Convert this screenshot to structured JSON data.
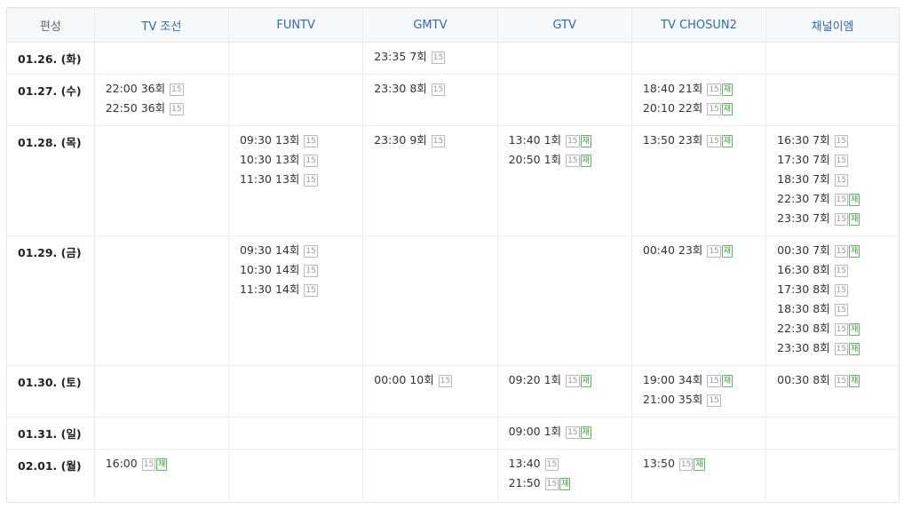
{
  "header": [
    "편성",
    "TV 조선",
    "FUNTV",
    "GMTV",
    "GTV",
    "TV CHOSUN2",
    "채널이엠"
  ],
  "rows": [
    {
      "date": "01.26. (화)",
      "h": 36,
      "cells": [
        [],
        [],
        [
          {
            "time": "23:35",
            "ep": "7회",
            "rating": "15",
            "re": ""
          }
        ],
        [],
        [],
        []
      ]
    },
    {
      "date": "01.27. (수)",
      "h": 58,
      "cells": [
        [
          {
            "time": "22:00",
            "ep": "36회",
            "rating": "15",
            "re": ""
          },
          {
            "time": "22:50",
            "ep": "36회",
            "rating": "15",
            "re": ""
          }
        ],
        [],
        [
          {
            "time": "23:30",
            "ep": "8회",
            "rating": "15",
            "re": ""
          }
        ],
        [],
        [
          {
            "time": "18:40",
            "ep": "21회",
            "rating": "15",
            "re": "재"
          },
          {
            "time": "20:10",
            "ep": "22회",
            "rating": "15",
            "re": "재"
          }
        ],
        []
      ]
    },
    {
      "date": "01.28. (목)",
      "h": 124,
      "cells": [
        [],
        [
          {
            "time": "09:30",
            "ep": "13회",
            "rating": "15",
            "re": ""
          },
          {
            "time": "10:30",
            "ep": "13회",
            "rating": "15",
            "re": ""
          },
          {
            "time": "11:30",
            "ep": "13회",
            "rating": "15",
            "re": ""
          }
        ],
        [
          {
            "time": "23:30",
            "ep": "9회",
            "rating": "15",
            "re": ""
          }
        ],
        [
          {
            "time": "13:40",
            "ep": "1회",
            "rating": "15",
            "re": "재"
          },
          {
            "time": "20:50",
            "ep": "1회",
            "rating": "15",
            "re": "재"
          }
        ],
        [
          {
            "time": "13:50",
            "ep": "23회",
            "rating": "15",
            "re": "재"
          }
        ],
        [
          {
            "time": "16:30",
            "ep": "7회",
            "rating": "15",
            "re": ""
          },
          {
            "time": "17:30",
            "ep": "7회",
            "rating": "15",
            "re": ""
          },
          {
            "time": "18:30",
            "ep": "7회",
            "rating": "15",
            "re": ""
          },
          {
            "time": "22:30",
            "ep": "7회",
            "rating": "15",
            "re": "재"
          },
          {
            "time": "23:30",
            "ep": "7회",
            "rating": "15",
            "re": "재"
          }
        ]
      ]
    },
    {
      "date": "01.29. (금)",
      "h": 146,
      "cells": [
        [],
        [
          {
            "time": "09:30",
            "ep": "14회",
            "rating": "15",
            "re": ""
          },
          {
            "time": "10:30",
            "ep": "14회",
            "rating": "15",
            "re": ""
          },
          {
            "time": "11:30",
            "ep": "14회",
            "rating": "15",
            "re": ""
          }
        ],
        [],
        [],
        [
          {
            "time": "00:40",
            "ep": "23회",
            "rating": "15",
            "re": "재"
          }
        ],
        [
          {
            "time": "00:30",
            "ep": "7회",
            "rating": "15",
            "re": "재"
          },
          {
            "time": "16:30",
            "ep": "8회",
            "rating": "15",
            "re": ""
          },
          {
            "time": "17:30",
            "ep": "8회",
            "rating": "15",
            "re": ""
          },
          {
            "time": "18:30",
            "ep": "8회",
            "rating": "15",
            "re": ""
          },
          {
            "time": "22:30",
            "ep": "8회",
            "rating": "15",
            "re": "재"
          },
          {
            "time": "23:30",
            "ep": "8회",
            "rating": "15",
            "re": "재"
          }
        ]
      ]
    },
    {
      "date": "01.30. (토)",
      "h": 58,
      "cells": [
        [],
        [],
        [
          {
            "time": "00:00",
            "ep": "10회",
            "rating": "15",
            "re": ""
          }
        ],
        [
          {
            "time": "09:20",
            "ep": "1회",
            "rating": "15",
            "re": "재"
          }
        ],
        [
          {
            "time": "19:00",
            "ep": "34회",
            "rating": "15",
            "re": "재"
          },
          {
            "time": "21:00",
            "ep": "35회",
            "rating": "15",
            "re": ""
          }
        ],
        [
          {
            "time": "00:30",
            "ep": "8회",
            "rating": "15",
            "re": "재"
          }
        ]
      ]
    },
    {
      "date": "01.31. (일)",
      "h": 36,
      "cells": [
        [],
        [],
        [],
        [
          {
            "time": "09:00",
            "ep": "1회",
            "rating": "15",
            "re": "재"
          }
        ],
        [],
        []
      ]
    },
    {
      "date": "02.01. (월)",
      "h": 58,
      "cells": [
        [
          {
            "time": "16:00",
            "ep": "",
            "rating": "15",
            "re": "재"
          }
        ],
        [],
        [],
        [
          {
            "time": "13:40",
            "ep": "",
            "rating": "15",
            "re": ""
          },
          {
            "time": "21:50",
            "ep": "",
            "rating": "15",
            "re": "재"
          }
        ],
        [
          {
            "time": "13:50",
            "ep": "",
            "rating": "15",
            "re": "재"
          }
        ],
        []
      ]
    }
  ]
}
